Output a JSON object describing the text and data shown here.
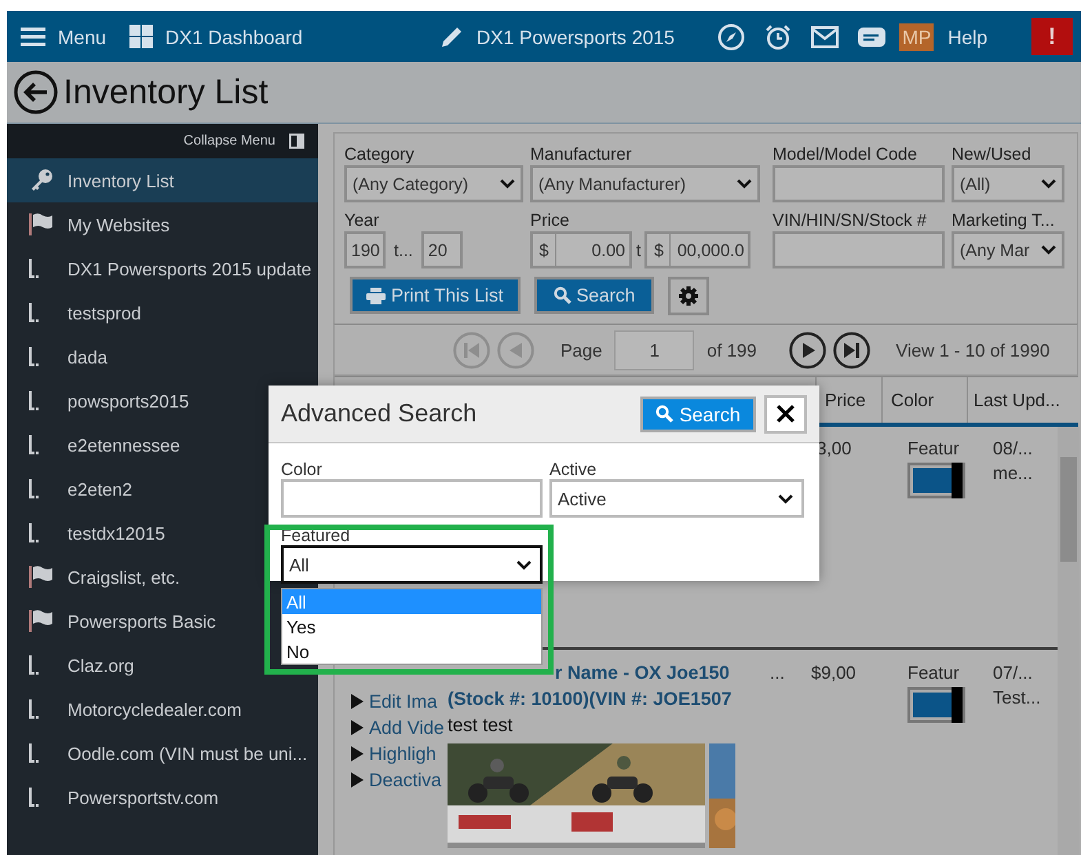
{
  "topbar": {
    "menu": "Menu",
    "dashboard": "DX1 Dashboard",
    "site": "DX1 Powersports 2015",
    "avatar": "MP",
    "help": "Help",
    "alert": "!"
  },
  "page_title": "Inventory List",
  "sidebar": {
    "collapse": "Collapse Menu",
    "items": [
      {
        "label": "Inventory List",
        "kind": "key",
        "selected": true
      },
      {
        "label": "My Websites",
        "kind": "flag",
        "selected": false,
        "children": [
          {
            "label": "DX1 Powersports 2015 update",
            "selected": false
          },
          {
            "label": "testsprod",
            "selected": false
          },
          {
            "label": "dada",
            "selected": false
          },
          {
            "label": "powsports2015",
            "selected": false
          },
          {
            "label": "e2etennessee",
            "selected": false
          },
          {
            "label": "e2eten2",
            "selected": false
          },
          {
            "label": "testdx12015",
            "selected": false
          }
        ]
      },
      {
        "label": "Craigslist, etc.",
        "kind": "flag",
        "selected": false
      },
      {
        "label": "Powersports Basic",
        "kind": "flag",
        "selected": false,
        "children": [
          {
            "label": "Claz.org",
            "selected": false
          },
          {
            "label": "Motorcycledealer.com",
            "selected": false
          },
          {
            "label": "Oodle.com (VIN must be uni...",
            "selected": false
          },
          {
            "label": "Powersportstv.com",
            "selected": false
          }
        ]
      }
    ]
  },
  "filters": {
    "category": {
      "label": "Category",
      "value": "(Any Category)"
    },
    "manufacturer": {
      "label": "Manufacturer",
      "value": "(Any Manufacturer)"
    },
    "model": {
      "label": "Model/Model Code"
    },
    "new_used": {
      "label": "New/Used",
      "value": "(All)"
    },
    "year": {
      "label": "Year",
      "from": "190",
      "sep": "t...",
      "to": "20"
    },
    "price": {
      "label": "Price",
      "currency_from": "$",
      "from": "0.00",
      "sep": "t",
      "currency_to": "$",
      "to": "00,000.0"
    },
    "vin": {
      "label": "VIN/HIN/SN/Stock #"
    },
    "marketing": {
      "label": "Marketing T...",
      "value": "(Any Mar"
    },
    "buttons": {
      "print": "Print This List",
      "search": "Search"
    }
  },
  "pagination": {
    "page_label": "Page",
    "page": "1",
    "of": "of 199",
    "view": "View 1 - 10 of 1990"
  },
  "table": {
    "columns": [
      "Price",
      "Color",
      "Last Upd..."
    ],
    "rows": [
      {
        "price": "3,00",
        "color_label": "Featur",
        "featured": true,
        "updated": [
          "08/...",
          "me..."
        ]
      },
      {
        "actions": [
          "Edit Ima",
          "Add Vide",
          "Highligh",
          "Deactiva"
        ],
        "title": "r Name - OX Joe150",
        "subtitle": "(Stock #: 10100)(VIN #: JOE1507",
        "description": "test test",
        "more": "...",
        "price": "$9,00",
        "color_label": "Featur",
        "featured": true,
        "updated": [
          "07/...",
          "Test..."
        ],
        "media": {
          "kind": "picture"
        }
      }
    ]
  },
  "modal": {
    "title": "Advanced Search",
    "search": "Search",
    "color": {
      "label": "Color"
    },
    "active": {
      "label": "Active",
      "value": "Active"
    },
    "featured": {
      "label": "Featured",
      "value": "All",
      "expanded": true,
      "options": [
        {
          "label": "All",
          "selected": true
        },
        {
          "label": "Yes",
          "selected": false
        },
        {
          "label": "No",
          "selected": false
        }
      ]
    }
  }
}
